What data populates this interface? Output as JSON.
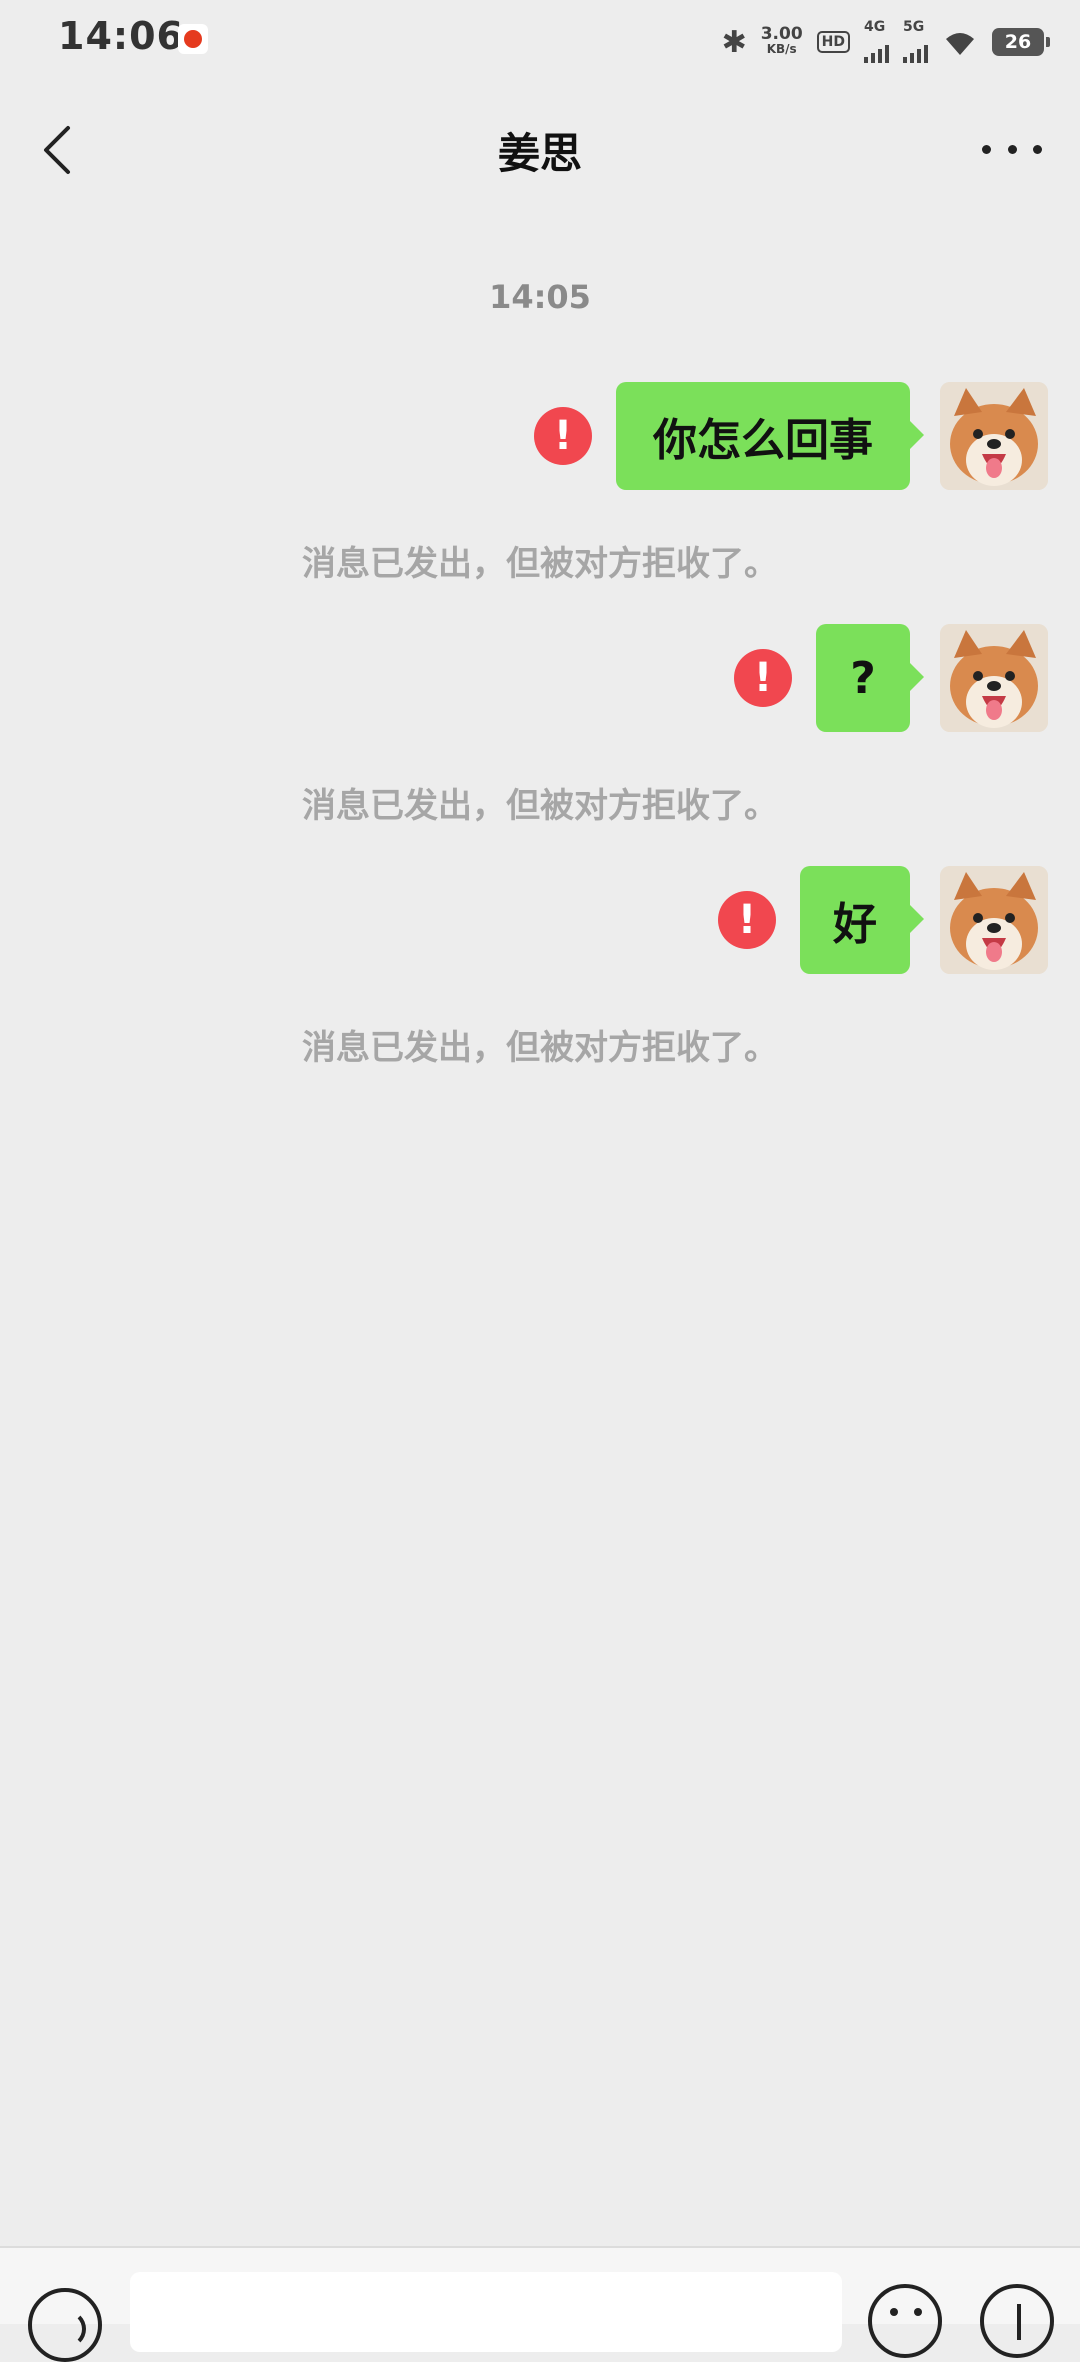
{
  "status_bar": {
    "time": "14:06",
    "net_speed_value": "3.00",
    "net_speed_unit": "KB/s",
    "hd_label": "HD",
    "signal1_label": "4G",
    "signal2_label": "5G",
    "battery": "26",
    "icons": [
      "bluetooth-icon",
      "hd-icon",
      "signal-icon",
      "wifi-icon",
      "battery-icon"
    ]
  },
  "header": {
    "title": "姜思"
  },
  "chat": {
    "timestamp": "14:05",
    "messages": [
      {
        "text": "你怎么回事",
        "status": "!",
        "notice": "消息已发出，但被对方拒收了。"
      },
      {
        "text": "?",
        "status": "!",
        "notice": "消息已发出，但被对方拒收了。"
      },
      {
        "text": "好",
        "status": "!",
        "notice": "消息已发出，但被对方拒收了。"
      }
    ]
  },
  "colors": {
    "background": "#ededed",
    "bubble": "#7be05a",
    "error": "#f1474f",
    "notice_text": "#a6a6a6"
  }
}
